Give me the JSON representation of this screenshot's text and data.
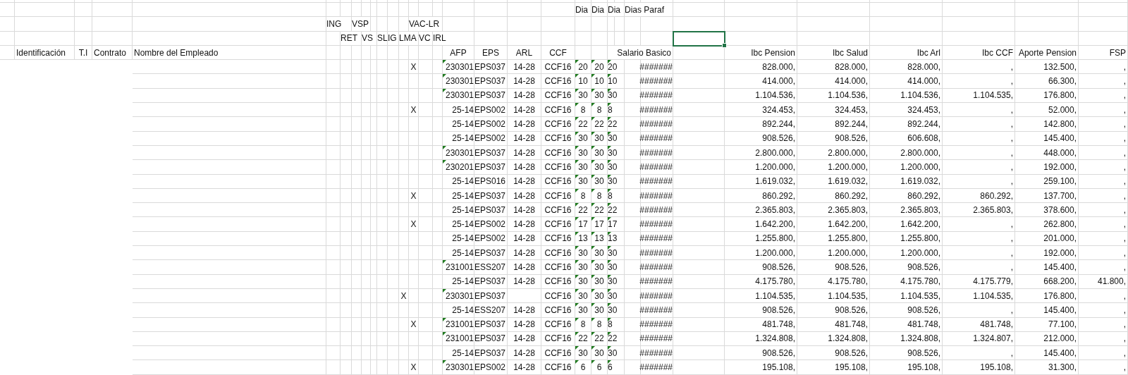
{
  "sheet": {
    "header_row_1": [
      "Dia",
      "Dia",
      "Dia",
      "Dias Paraf"
    ],
    "header_row_2": [
      "ING",
      "VSP",
      "VAC-LR"
    ],
    "header_row_3": [
      "RET",
      "VS",
      "SL",
      "IG",
      "LMA",
      "VC",
      "IRL"
    ],
    "columns": [
      "Identificación",
      "T.I",
      "Contrato",
      "Nombre del Empleado",
      "AFP",
      "EPS",
      "ARL",
      "CCF",
      "Salario Basico",
      "Ibc Pension",
      "Ibc Salud",
      "Ibc Arl",
      "Ibc CCF",
      "Aporte Pension",
      "FSP"
    ],
    "rows": [
      {
        "vac": "X",
        "afp": "230301",
        "afp_flag": true,
        "eps": "EPS037",
        "arl": "14-28",
        "ccf": "CCF16",
        "dias": [
          "20",
          "20",
          "20"
        ],
        "dias_flag": true,
        "salario": "#######",
        "ibc_pension": "828.000,",
        "ibc_salud": "828.000,",
        "ibc_arl": "828.000,",
        "ibc_ccf": ",",
        "aporte_pension": "132.500,",
        "fsp": ","
      },
      {
        "afp": "230301",
        "afp_flag": true,
        "eps": "EPS037",
        "arl": "14-28",
        "ccf": "CCF16",
        "dias": [
          "10",
          "10",
          "10"
        ],
        "dias_flag": true,
        "salario": "#######",
        "ibc_pension": "414.000,",
        "ibc_salud": "414.000,",
        "ibc_arl": "414.000,",
        "ibc_ccf": ",",
        "aporte_pension": "66.300,",
        "fsp": ","
      },
      {
        "afp": "230301",
        "afp_flag": true,
        "eps": "EPS037",
        "arl": "14-28",
        "ccf": "CCF16",
        "dias": [
          "30",
          "30",
          "30"
        ],
        "dias_flag": true,
        "salario": "#######",
        "ibc_pension": "1.104.536,",
        "ibc_salud": "1.104.536,",
        "ibc_arl": "1.104.536,",
        "ibc_ccf": "1.104.535,",
        "aporte_pension": "176.800,",
        "fsp": ","
      },
      {
        "vac": "X",
        "afp": "25-14",
        "afp_flag": false,
        "eps": "EPS002",
        "arl": "14-28",
        "ccf": "CCF16",
        "dias": [
          "8",
          "8",
          "8"
        ],
        "dias_flag": true,
        "salario": "#######",
        "ibc_pension": "324.453,",
        "ibc_salud": "324.453,",
        "ibc_arl": "324.453,",
        "ibc_ccf": ",",
        "aporte_pension": "52.000,",
        "fsp": ","
      },
      {
        "afp": "25-14",
        "afp_flag": false,
        "eps": "EPS002",
        "arl": "14-28",
        "ccf": "CCF16",
        "dias": [
          "22",
          "22",
          "22"
        ],
        "dias_flag": true,
        "salario": "#######",
        "ibc_pension": "892.244,",
        "ibc_salud": "892.244,",
        "ibc_arl": "892.244,",
        "ibc_ccf": ",",
        "aporte_pension": "142.800,",
        "fsp": ","
      },
      {
        "afp": "25-14",
        "afp_flag": false,
        "eps": "EPS002",
        "arl": "14-28",
        "ccf": "CCF16",
        "dias": [
          "30",
          "30",
          "30"
        ],
        "dias_flag": true,
        "salario": "#######",
        "ibc_pension": "908.526,",
        "ibc_salud": "908.526,",
        "ibc_arl": "606.608,",
        "ibc_ccf": ",",
        "aporte_pension": "145.400,",
        "fsp": ","
      },
      {
        "afp": "230301",
        "afp_flag": true,
        "eps": "EPS037",
        "arl": "14-28",
        "ccf": "CCF16",
        "dias": [
          "30",
          "30",
          "30"
        ],
        "dias_flag": true,
        "salario": "#######",
        "ibc_pension": "2.800.000,",
        "ibc_salud": "2.800.000,",
        "ibc_arl": "2.800.000,",
        "ibc_ccf": ",",
        "aporte_pension": "448.000,",
        "fsp": ","
      },
      {
        "afp": "230201",
        "afp_flag": true,
        "eps": "EPS037",
        "arl": "14-28",
        "ccf": "CCF16",
        "dias": [
          "30",
          "30",
          "30"
        ],
        "dias_flag": true,
        "salario": "#######",
        "ibc_pension": "1.200.000,",
        "ibc_salud": "1.200.000,",
        "ibc_arl": "1.200.000,",
        "ibc_ccf": ",",
        "aporte_pension": "192.000,",
        "fsp": ","
      },
      {
        "afp": "25-14",
        "afp_flag": false,
        "eps": "EPS016",
        "arl": "14-28",
        "ccf": "CCF16",
        "dias": [
          "30",
          "30",
          "30"
        ],
        "dias_flag": true,
        "salario": "#######",
        "ibc_pension": "1.619.032,",
        "ibc_salud": "1.619.032,",
        "ibc_arl": "1.619.032,",
        "ibc_ccf": ",",
        "aporte_pension": "259.100,",
        "fsp": ","
      },
      {
        "vac": "X",
        "afp": "25-14",
        "afp_flag": false,
        "eps": "EPS037",
        "arl": "14-28",
        "ccf": "CCF16",
        "dias": [
          "8",
          "8",
          "8"
        ],
        "dias_flag": true,
        "salario": "#######",
        "ibc_pension": "860.292,",
        "ibc_salud": "860.292,",
        "ibc_arl": "860.292,",
        "ibc_ccf": "860.292,",
        "aporte_pension": "137.700,",
        "fsp": ","
      },
      {
        "afp": "25-14",
        "afp_flag": false,
        "eps": "EPS037",
        "arl": "14-28",
        "ccf": "CCF16",
        "dias": [
          "22",
          "22",
          "22"
        ],
        "dias_flag": true,
        "salario": "#######",
        "ibc_pension": "2.365.803,",
        "ibc_salud": "2.365.803,",
        "ibc_arl": "2.365.803,",
        "ibc_ccf": "2.365.803,",
        "aporte_pension": "378.600,",
        "fsp": ","
      },
      {
        "vac": "X",
        "afp": "25-14",
        "afp_flag": false,
        "eps": "EPS002",
        "arl": "14-28",
        "ccf": "CCF16",
        "dias": [
          "17",
          "17",
          "17"
        ],
        "dias_flag": true,
        "salario": "#######",
        "ibc_pension": "1.642.200,",
        "ibc_salud": "1.642.200,",
        "ibc_arl": "1.642.200,",
        "ibc_ccf": ",",
        "aporte_pension": "262.800,",
        "fsp": ","
      },
      {
        "afp": "25-14",
        "afp_flag": false,
        "eps": "EPS002",
        "arl": "14-28",
        "ccf": "CCF16",
        "dias": [
          "13",
          "13",
          "13"
        ],
        "dias_flag": true,
        "salario": "#######",
        "ibc_pension": "1.255.800,",
        "ibc_salud": "1.255.800,",
        "ibc_arl": "1.255.800,",
        "ibc_ccf": ",",
        "aporte_pension": "201.000,",
        "fsp": ","
      },
      {
        "afp": "25-14",
        "afp_flag": false,
        "eps": "EPS037",
        "arl": "14-28",
        "ccf": "CCF16",
        "dias": [
          "30",
          "30",
          "30"
        ],
        "dias_flag": true,
        "salario": "#######",
        "ibc_pension": "1.200.000,",
        "ibc_salud": "1.200.000,",
        "ibc_arl": "1.200.000,",
        "ibc_ccf": ",",
        "aporte_pension": "192.000,",
        "fsp": ","
      },
      {
        "afp": "231001",
        "afp_flag": true,
        "eps": "ESS207",
        "arl": "14-28",
        "ccf": "CCF16",
        "dias": [
          "30",
          "30",
          "30"
        ],
        "dias_flag": true,
        "salario": "#######",
        "ibc_pension": "908.526,",
        "ibc_salud": "908.526,",
        "ibc_arl": "908.526,",
        "ibc_ccf": ",",
        "aporte_pension": "145.400,",
        "fsp": ","
      },
      {
        "afp": "25-14",
        "afp_flag": false,
        "eps": "EPS037",
        "arl": "14-28",
        "ccf": "CCF16",
        "dias": [
          "30",
          "30",
          "30"
        ],
        "dias_flag": true,
        "salario": "#######",
        "ibc_pension": "4.175.780,",
        "ibc_salud": "4.175.780,",
        "ibc_arl": "4.175.780,",
        "ibc_ccf": "4.175.779,",
        "aporte_pension": "668.200,",
        "fsp": "41.800,"
      },
      {
        "lma": "X",
        "afp": "230301",
        "afp_flag": true,
        "eps": "EPS037",
        "ccf": "CCF16",
        "dias": [
          "30",
          "30",
          "30"
        ],
        "dias_flag": true,
        "salario": "#######",
        "ibc_pension": "1.104.535,",
        "ibc_salud": "1.104.535,",
        "ibc_arl": "1.104.535,",
        "ibc_ccf": "1.104.535,",
        "aporte_pension": "176.800,",
        "fsp": ","
      },
      {
        "afp": "25-14",
        "afp_flag": false,
        "eps": "ESS207",
        "arl": "14-28",
        "ccf": "CCF16",
        "dias": [
          "30",
          "30",
          "30"
        ],
        "dias_flag": true,
        "salario": "#######",
        "ibc_pension": "908.526,",
        "ibc_salud": "908.526,",
        "ibc_arl": "908.526,",
        "ibc_ccf": ",",
        "aporte_pension": "145.400,",
        "fsp": ","
      },
      {
        "vac": "X",
        "afp": "231001",
        "afp_flag": true,
        "eps": "EPS037",
        "arl": "14-28",
        "ccf": "CCF16",
        "dias": [
          "8",
          "8",
          "8"
        ],
        "dias_flag": true,
        "salario": "#######",
        "ibc_pension": "481.748,",
        "ibc_salud": "481.748,",
        "ibc_arl": "481.748,",
        "ibc_ccf": "481.748,",
        "aporte_pension": "77.100,",
        "fsp": ","
      },
      {
        "afp": "231001",
        "afp_flag": true,
        "eps": "EPS037",
        "arl": "14-28",
        "ccf": "CCF16",
        "dias": [
          "22",
          "22",
          "22"
        ],
        "dias_flag": true,
        "salario": "#######",
        "ibc_pension": "1.324.808,",
        "ibc_salud": "1.324.808,",
        "ibc_arl": "1.324.808,",
        "ibc_ccf": "1.324.807,",
        "aporte_pension": "212.000,",
        "fsp": ","
      },
      {
        "afp": "25-14",
        "afp_flag": false,
        "eps": "EPS037",
        "arl": "14-28",
        "ccf": "CCF16",
        "dias": [
          "30",
          "30",
          "30"
        ],
        "dias_flag": true,
        "salario": "#######",
        "ibc_pension": "908.526,",
        "ibc_salud": "908.526,",
        "ibc_arl": "908.526,",
        "ibc_ccf": ",",
        "aporte_pension": "145.400,",
        "fsp": ","
      },
      {
        "vac": "X",
        "afp": "230301",
        "afp_flag": true,
        "eps": "EPS002",
        "arl": "14-28",
        "ccf": "CCF16",
        "dias": [
          "6",
          "6",
          "6"
        ],
        "dias_flag": true,
        "salario": "#######",
        "ibc_pension": "195.108,",
        "ibc_salud": "195.108,",
        "ibc_arl": "195.108,",
        "ibc_ccf": "195.108,",
        "aporte_pension": "31.300,",
        "fsp": ","
      }
    ]
  }
}
